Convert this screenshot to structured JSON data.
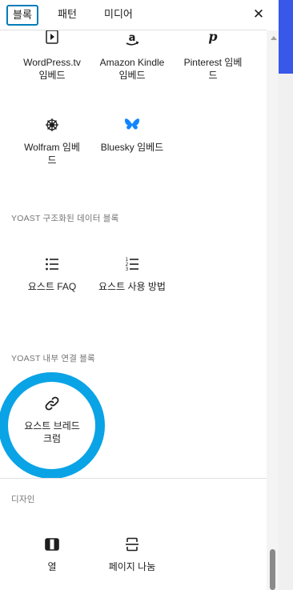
{
  "tabs": [
    {
      "label": "블록",
      "active": true
    },
    {
      "label": "패턴",
      "active": false
    },
    {
      "label": "미디어",
      "active": false
    }
  ],
  "close_icon": "close-icon",
  "embeds_row1": [
    {
      "label": "WordPress.tv 임베드",
      "icon": "video-play-icon"
    },
    {
      "label": "Amazon Kindle 임베드",
      "icon": "amazon-icon"
    },
    {
      "label": "Pinterest 임베드",
      "icon": "pinterest-icon"
    }
  ],
  "embeds_row2": [
    {
      "label": "Wolfram 임베드",
      "icon": "wolfram-icon"
    },
    {
      "label": "Bluesky 임베드",
      "icon": "bluesky-icon"
    }
  ],
  "yoast_structured": {
    "title": "YOAST 구조화된 데이터 블록",
    "items": [
      {
        "label": "요스트 FAQ",
        "icon": "list-icon"
      },
      {
        "label": "요스트 사용 방법",
        "icon": "ordered-list-icon"
      }
    ]
  },
  "yoast_internal": {
    "title": "YOAST 내부 연결 블록",
    "items": [
      {
        "label": "요스트 브레드 크럼",
        "icon": "link-icon"
      }
    ]
  },
  "design": {
    "title": "디자인",
    "items": [
      {
        "label": "열",
        "icon": "columns-icon"
      },
      {
        "label": "페이지 나눔",
        "icon": "page-break-icon"
      }
    ]
  },
  "colors": {
    "accent": "#007cba",
    "highlight_ring": "#0aa3e6",
    "bluesky": "#1185fe",
    "admin_bar": "#3858e9"
  }
}
